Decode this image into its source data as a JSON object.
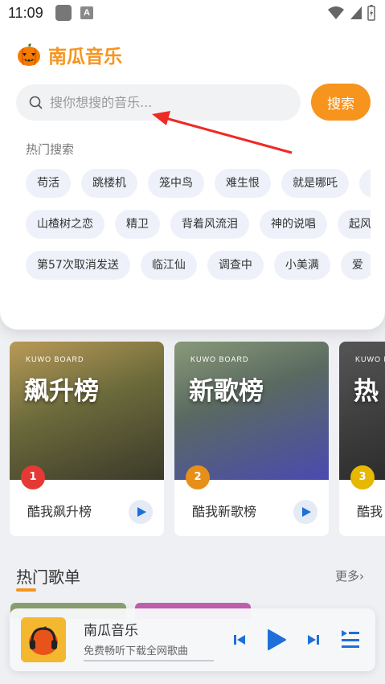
{
  "status": {
    "time": "11:09",
    "icon_a": "A"
  },
  "app": {
    "name": "南瓜音乐",
    "accent": "#f7941d"
  },
  "search": {
    "placeholder": "搜你想搜的音乐...",
    "value": "",
    "button": "搜索"
  },
  "hot_search": {
    "title": "热门搜索",
    "rows": [
      [
        "苟活",
        "跳楼机",
        "笼中鸟",
        "难生恨",
        "就是哪吒",
        "…"
      ],
      [
        "山楂树之恋",
        "精卫",
        "背着风流泪",
        "神的说唱",
        "起风了"
      ],
      [
        "第57次取消发送",
        "临江仙",
        "调查中",
        "小美满",
        "爱"
      ]
    ]
  },
  "rank_cards": [
    {
      "cover_text": "飙升榜",
      "board": "KUWO BOARD",
      "rank": "1",
      "name": "酷我飙升榜",
      "badge_color": "#e53935"
    },
    {
      "cover_text": "新歌榜",
      "board": "KUWO BOARD",
      "rank": "2",
      "name": "酷我新歌榜",
      "badge_color": "#e6901a"
    },
    {
      "cover_text": "热",
      "board": "KUWO BOARD",
      "rank": "3",
      "name": "酷我",
      "badge_color": "#e6b800"
    }
  ],
  "hot_playlists": {
    "title": "热门歌单",
    "more": "更多›"
  },
  "player": {
    "title": "南瓜音乐",
    "subtitle": "免费畅听下载全网歌曲"
  }
}
